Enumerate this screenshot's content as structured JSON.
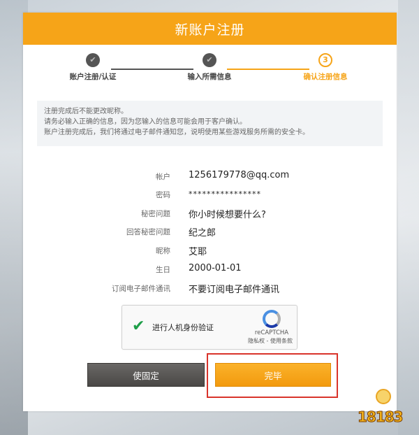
{
  "header": {
    "title": "新账户注册"
  },
  "steps": [
    {
      "label": "账户注册/认证",
      "state": "done"
    },
    {
      "label": "输入所需信息",
      "state": "done"
    },
    {
      "label": "确认注册信息",
      "state": "active",
      "number": "3"
    }
  ],
  "notice": [
    "注册完成后不能更改昵称。",
    "请务必输入正确的信息，因为您输入的信息可能会用于客户确认。",
    "账户注册完成后，我们将通过电子邮件通知您，说明使用某些游戏服务所需的安全卡。"
  ],
  "fields": [
    {
      "label": "帐户",
      "value": "1256179778@qq.com"
    },
    {
      "label": "密码",
      "value": "****************"
    },
    {
      "label": "秘密问题",
      "value": "你小时候想要什么?"
    },
    {
      "label": "回答秘密问题",
      "value": "纪之郎"
    },
    {
      "label": "昵称",
      "value": "艾耶"
    },
    {
      "label": "生日",
      "value": "2000-01-01"
    },
    {
      "label": "订阅电子邮件通讯",
      "value": "不要订阅电子邮件通讯"
    }
  ],
  "captcha": {
    "label": "进行人机身份验证",
    "brand": "reCAPTCHA",
    "privacy": "隐私权",
    "separator": " - ",
    "terms": "使用条款"
  },
  "buttons": {
    "default_label": "使固定",
    "complete_label": "完毕"
  },
  "watermark": {
    "text": "18183"
  },
  "colors": {
    "accent": "#f6a418",
    "highlight": "#d9342b",
    "check": "#1e9e48"
  }
}
